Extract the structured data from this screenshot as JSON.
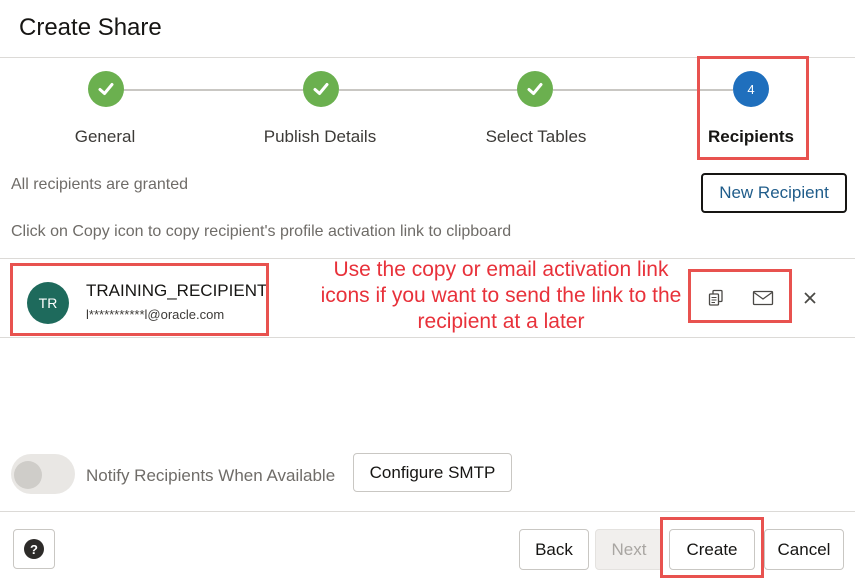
{
  "dialog": {
    "title": "Create Share"
  },
  "steps": [
    {
      "label": "General",
      "state": "done"
    },
    {
      "label": "Publish Details",
      "state": "done"
    },
    {
      "label": "Select Tables",
      "state": "done"
    },
    {
      "label": "Recipients",
      "state": "current",
      "number": "4"
    }
  ],
  "recipients_section": {
    "granted_text": "All recipients are granted",
    "new_recipient_label": "New Recipient",
    "copy_hint": "Click on Copy icon to copy recipient's profile activation link to clipboard"
  },
  "recipient": {
    "initials": "TR",
    "name": "TRAINING_RECIPIENT",
    "email": "l***********l@oracle.com"
  },
  "annotation": {
    "text": "Use the copy or email activation link icons if you want to send the link to the recipient at a later",
    "color": "#e8313a"
  },
  "notify": {
    "label": "Notify Recipients When Available",
    "configure_label": "Configure SMTP"
  },
  "footer": {
    "help_label": "?",
    "back_label": "Back",
    "next_label": "Next",
    "create_label": "Create",
    "cancel_label": "Cancel"
  },
  "colors": {
    "step_done": "#6bb04f",
    "step_current": "#1f6fbd",
    "avatar": "#1e6a5c",
    "highlight": "#e8524f"
  }
}
